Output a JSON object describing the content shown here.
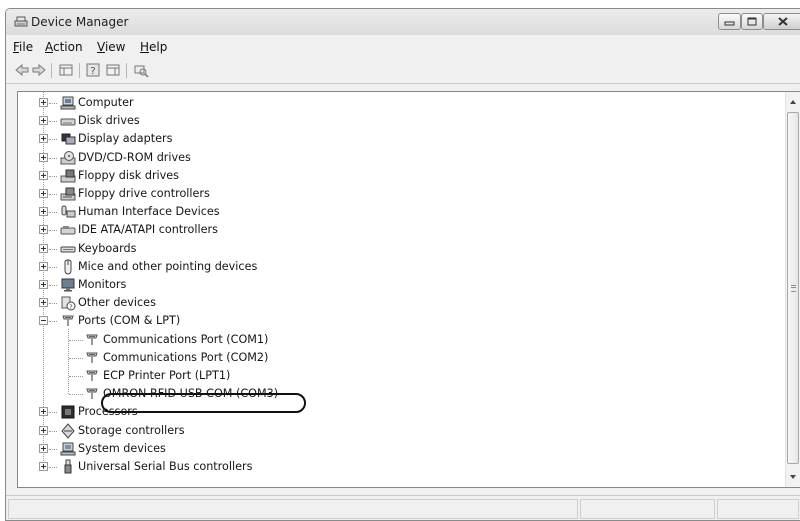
{
  "window": {
    "title": "Device Manager"
  },
  "menu": [
    {
      "label": "File"
    },
    {
      "label": "Action"
    },
    {
      "label": "View"
    },
    {
      "label": "Help"
    }
  ],
  "toolbar": {
    "buttons": [
      {
        "icon": "back-arrow-icon"
      },
      {
        "icon": "forward-arrow-icon"
      },
      {
        "icon": "show-hide-console-tree-icon"
      },
      {
        "icon": "help-icon"
      },
      {
        "icon": "show-hide-action-pane-icon"
      },
      {
        "icon": "scan-hardware-changes-icon"
      }
    ]
  },
  "tree": {
    "categories": [
      {
        "label": "Computer",
        "icon": "computer-icon",
        "expanded": false
      },
      {
        "label": "Disk drives",
        "icon": "disk-drive-icon",
        "expanded": false
      },
      {
        "label": "Display adapters",
        "icon": "display-adapter-icon",
        "expanded": false
      },
      {
        "label": "DVD/CD-ROM drives",
        "icon": "dvd-drive-icon",
        "expanded": false
      },
      {
        "label": "Floppy disk drives",
        "icon": "floppy-drive-icon",
        "expanded": false
      },
      {
        "label": "Floppy drive controllers",
        "icon": "floppy-controller-icon",
        "expanded": false
      },
      {
        "label": "Human Interface Devices",
        "icon": "hid-icon",
        "expanded": false
      },
      {
        "label": "IDE ATA/ATAPI controllers",
        "icon": "ide-controller-icon",
        "expanded": false
      },
      {
        "label": "Keyboards",
        "icon": "keyboard-icon",
        "expanded": false
      },
      {
        "label": "Mice and other pointing devices",
        "icon": "mouse-icon",
        "expanded": false
      },
      {
        "label": "Monitors",
        "icon": "monitor-icon",
        "expanded": false
      },
      {
        "label": "Other devices",
        "icon": "unknown-device-icon",
        "expanded": false
      },
      {
        "label": "Ports (COM & LPT)",
        "icon": "port-icon",
        "expanded": true,
        "children": [
          {
            "label": "Communications Port (COM1)",
            "icon": "port-icon"
          },
          {
            "label": "Communications Port (COM2)",
            "icon": "port-icon"
          },
          {
            "label": "ECP Printer Port (LPT1)",
            "icon": "port-icon"
          },
          {
            "label": "OMRON RFID USB COM (COM3)",
            "icon": "port-icon",
            "circled": true
          }
        ]
      },
      {
        "label": "Processors",
        "icon": "processor-icon",
        "expanded": false
      },
      {
        "label": "Storage controllers",
        "icon": "storage-controller-icon",
        "expanded": false
      },
      {
        "label": "System devices",
        "icon": "system-device-icon",
        "expanded": false
      },
      {
        "label": "Universal Serial Bus controllers",
        "icon": "usb-icon",
        "expanded": false
      }
    ]
  },
  "statusbar": {
    "text": ""
  }
}
